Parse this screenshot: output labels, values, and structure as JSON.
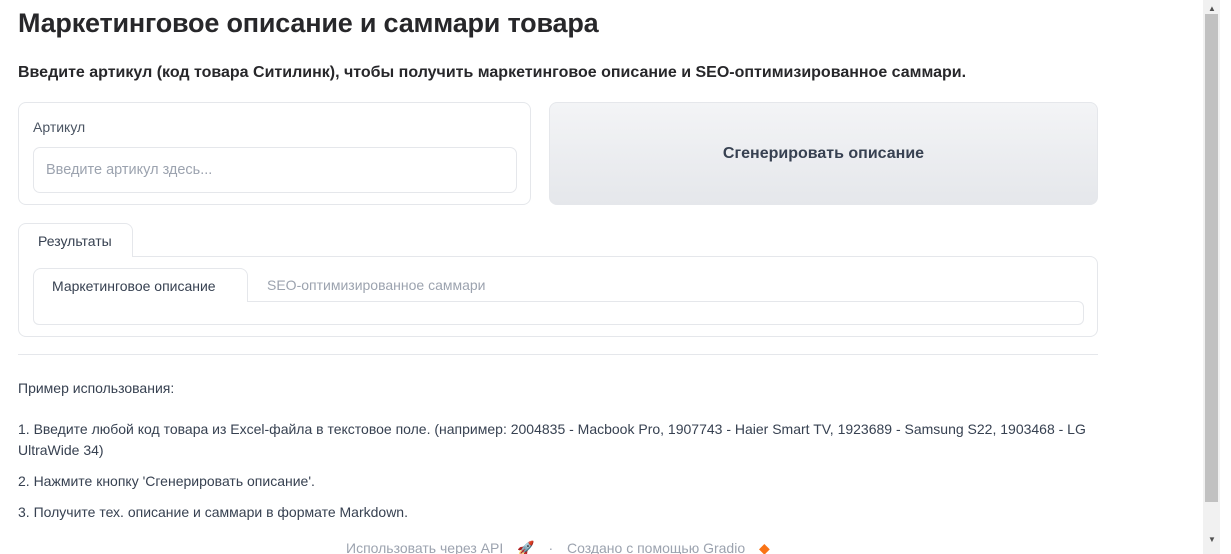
{
  "header": {
    "title": "Маркетинговое описание и саммари товара",
    "subtitle": "Введите артикул (код товара Ситилинк), чтобы получить маркетинговое описание и SEO-оптимизированное саммари."
  },
  "form": {
    "article_label": "Артикул",
    "article_placeholder": "Введите артикул здесь...",
    "article_value": "",
    "generate_button": "Сгенерировать описание"
  },
  "results": {
    "outer_tab": "Результаты",
    "tabs": [
      {
        "label": "Маркетинговое описание",
        "active": true
      },
      {
        "label": "SEO-оптимизированное саммари",
        "active": false
      }
    ]
  },
  "usage": {
    "heading": "Пример использования:",
    "steps": [
      "1. Введите любой код товара из Excel-файла в текстовое поле. (например: 2004835 - Macbook Pro, 1907743 - Haier Smart TV, 1923689 - Samsung S22, 1903468 - LG UltraWide 34)",
      "2. Нажмите кнопку 'Сгенерировать описание'.",
      "3. Получите тех. описание и саммари в формате Markdown."
    ]
  },
  "footer": {
    "api_link": "Использовать через API",
    "built_with": "Создано с помощью Gradio"
  },
  "icons": {
    "api": "rocket-icon",
    "gradio": "gradio-logo-icon"
  }
}
